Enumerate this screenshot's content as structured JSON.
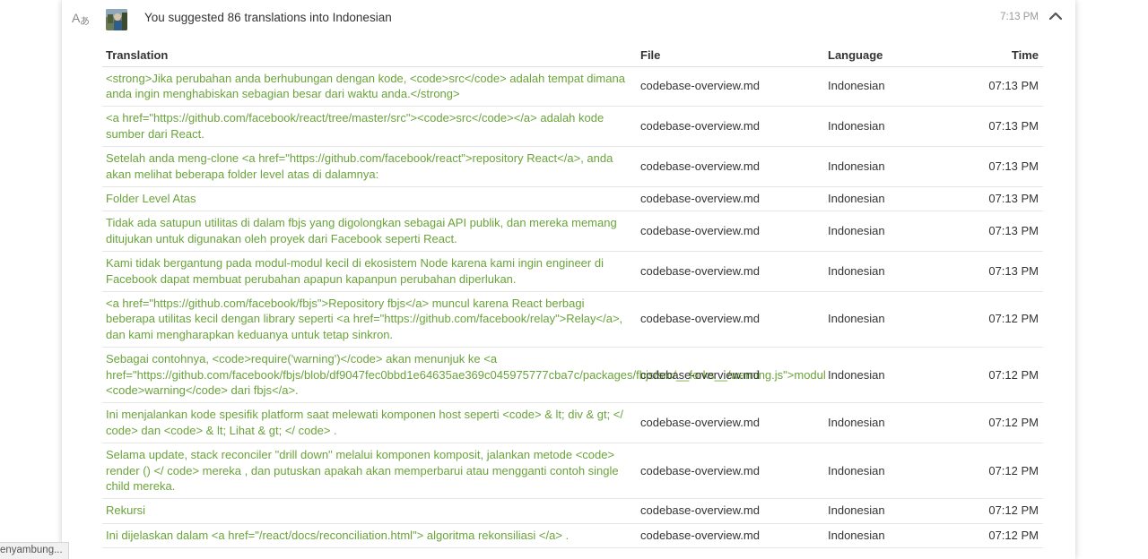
{
  "activity": {
    "title": "You suggested 86 translations into Indonesian",
    "time": "7:13 PM",
    "icons": {
      "type": "translate-icon",
      "avatar": "avatar",
      "collapse": "chevron-up-icon"
    }
  },
  "table": {
    "headers": {
      "translation": "Translation",
      "file": "File",
      "language": "Language",
      "time": "Time"
    },
    "rows": [
      {
        "translation": "<strong>Jika perubahan anda berhubungan dengan kode, <code>src</code> adalah tempat dimana anda ingin menghabiskan sebagian besar dari waktu anda.</strong>",
        "file": "codebase-overview.md",
        "language": "Indonesian",
        "time": "07:13 PM"
      },
      {
        "translation": "<a href=\"https://github.com/facebook/react/tree/master/src\"><code>src</code></a> adalah kode sumber dari React.",
        "file": "codebase-overview.md",
        "language": "Indonesian",
        "time": "07:13 PM"
      },
      {
        "translation": "Setelah anda meng-clone <a href=\"https://github.com/facebook/react\">repository React</a>, anda akan melihat beberapa folder level atas di dalamnya:",
        "file": "codebase-overview.md",
        "language": "Indonesian",
        "time": "07:13 PM"
      },
      {
        "translation": "Folder Level Atas",
        "file": "codebase-overview.md",
        "language": "Indonesian",
        "time": "07:13 PM"
      },
      {
        "translation": "Tidak ada satupun utilitas di dalam fbjs yang digolongkan sebagai API publik, dan mereka memang ditujukan untuk digunakan oleh proyek dari Facebook seperti React.",
        "file": "codebase-overview.md",
        "language": "Indonesian",
        "time": "07:13 PM"
      },
      {
        "translation": "Kami tidak bergantung pada modul-modul kecil di ekosistem Node karena kami ingin engineer di Facebook dapat membuat perubahan apapun kapanpun perubahan diperlukan.",
        "file": "codebase-overview.md",
        "language": "Indonesian",
        "time": "07:13 PM"
      },
      {
        "translation": "<a href=\"https://github.com/facebook/fbjs\">Repository fbjs</a> muncul karena React berbagi beberapa utilitas kecil dengan library seperti <a href=\"https://github.com/facebook/relay\">Relay</a>, dan kami mengharapkan keduanya untuk tetap sinkron.",
        "file": "codebase-overview.md",
        "language": "Indonesian",
        "time": "07:12 PM"
      },
      {
        "translation": "Sebagai contohnya, <code>require('warning')</code> akan menunjuk ke <a href=\"https://github.com/facebook/fbjs/blob/df9047fec0bbd1e64635ae369c045975777cba7c/packages/fbjs/src/__forks__/warning.js\">modul <code>warning</code> dari fbjs</a>.",
        "file": "codebase-overview.md",
        "language": "Indonesian",
        "time": "07:12 PM"
      },
      {
        "translation": "Ini menjalankan kode spesifik platform saat melewati komponen host seperti <code> & lt; div & gt; </ code> dan <code> & lt; Lihat & gt; </ code> .",
        "file": "codebase-overview.md",
        "language": "Indonesian",
        "time": "07:12 PM"
      },
      {
        "translation": "Selama update, stack reconciler \"drill down\" melalui komponen komposit, jalankan metode <code> render () </ code> mereka , dan putuskan apakah akan memperbarui atau mengganti contoh single child mereka.",
        "file": "codebase-overview.md",
        "language": "Indonesian",
        "time": "07:12 PM"
      },
      {
        "translation": "Rekursi",
        "file": "codebase-overview.md",
        "language": "Indonesian",
        "time": "07:12 PM"
      },
      {
        "translation": "Ini dijelaskan dalam <a href=\"/react/docs/reconciliation.html\"> algoritma rekonsiliasi </a> .",
        "file": "codebase-overview.md",
        "language": "Indonesian",
        "time": "07:12 PM"
      }
    ]
  },
  "status_bar": {
    "text": "enyambung..."
  },
  "colors": {
    "translation_link": "#6aa33a",
    "text": "#333333",
    "muted": "#999999",
    "border": "#e6e6e6"
  }
}
